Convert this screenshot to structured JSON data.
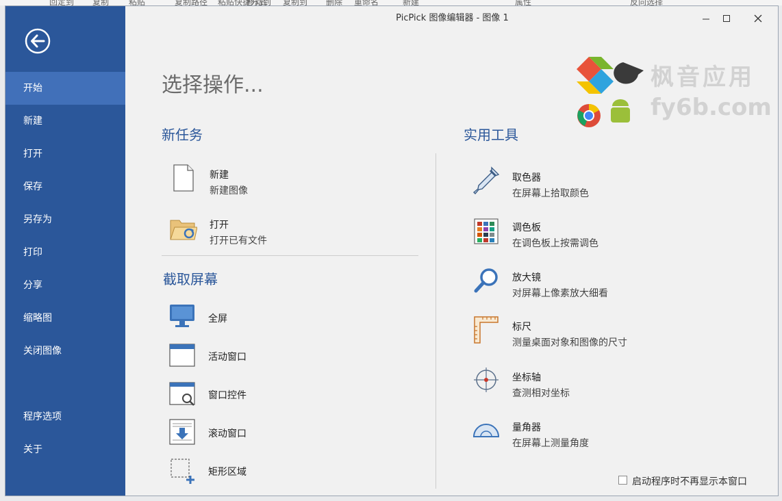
{
  "background_app": {
    "labels": [
      "回定到",
      "复制",
      "粘贴",
      "复制路径",
      "粘贴快捷方式",
      "移动到",
      "复制到",
      "删除",
      "重命名",
      "新建",
      "属性",
      "反向选择"
    ]
  },
  "window": {
    "title": "PicPick 图像编辑器 - 图像 1"
  },
  "sidebar": {
    "items": [
      {
        "label": "开始"
      },
      {
        "label": "新建"
      },
      {
        "label": "打开"
      },
      {
        "label": "保存"
      },
      {
        "label": "另存为"
      },
      {
        "label": "打印"
      },
      {
        "label": "分享"
      },
      {
        "label": "缩略图"
      },
      {
        "label": "关闭图像"
      },
      {
        "label": "程序选项"
      },
      {
        "label": "关于"
      }
    ]
  },
  "main": {
    "heading": "选择操作...",
    "new_task": {
      "title": "新任务",
      "items": [
        {
          "label": "新建",
          "desc": "新建图像",
          "icon": "blank-page-icon"
        },
        {
          "label": "打开",
          "desc": "打开已有文件",
          "icon": "open-folder-icon"
        }
      ]
    },
    "capture": {
      "title": "截取屏幕",
      "items": [
        {
          "label": "全屏",
          "icon": "monitor-icon"
        },
        {
          "label": "活动窗口",
          "icon": "window-icon"
        },
        {
          "label": "窗口控件",
          "icon": "window-control-icon"
        },
        {
          "label": "滚动窗口",
          "icon": "scroll-window-icon"
        },
        {
          "label": "矩形区域",
          "icon": "rect-region-icon"
        }
      ]
    },
    "tools": {
      "title": "实用工具",
      "items": [
        {
          "label": "取色器",
          "desc": "在屏幕上拾取颜色",
          "icon": "eyedropper-icon"
        },
        {
          "label": "调色板",
          "desc": "在调色板上按需调色",
          "icon": "palette-icon"
        },
        {
          "label": "放大镜",
          "desc": "对屏幕上像素放大细看",
          "icon": "magnifier-icon"
        },
        {
          "label": "标尺",
          "desc": "测量桌面对象和图像的尺寸",
          "icon": "ruler-icon"
        },
        {
          "label": "坐标轴",
          "desc": "查测相对坐标",
          "icon": "crosshair-icon"
        },
        {
          "label": "量角器",
          "desc": "在屏幕上测量角度",
          "icon": "protractor-icon"
        }
      ]
    },
    "startup_checkbox": {
      "label": "启动程序时不再显示本窗口",
      "checked": false
    }
  },
  "watermark": {
    "cn": "枫音应用",
    "en": "fy6b.com"
  },
  "colors": {
    "sidebar": "#2b579a",
    "sidebar_active": "#4170b9",
    "accent": "#2b579a"
  }
}
